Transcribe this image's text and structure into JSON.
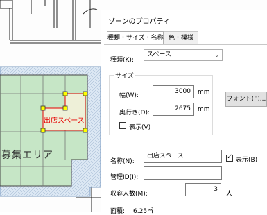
{
  "canvas": {
    "area_label": "募集エリア",
    "shop_label": "出店スペース"
  },
  "dialog": {
    "title": "ゾーンのプロパティ",
    "tabs": [
      {
        "label": "種類・サイズ・名称",
        "active": true
      },
      {
        "label": "色・模様",
        "active": false
      }
    ],
    "type": {
      "label": "種類(K):",
      "value": "スペース"
    },
    "size_group": {
      "title": "サイズ",
      "width": {
        "label": "幅(W):",
        "value": "3000",
        "unit": "mm"
      },
      "depth": {
        "label": "奥行き(D):",
        "value": "2675",
        "unit": "mm"
      },
      "show": {
        "label": "表示(V)",
        "checked": false
      }
    },
    "font_button": "フォント(F)...",
    "name": {
      "label": "名称(N):",
      "value": "出店スペース"
    },
    "name_show": {
      "label": "表示(B)",
      "checked": true
    },
    "manage_id": {
      "label": "管理ID(I):",
      "value": ""
    },
    "capacity": {
      "label": "収容人数(M):",
      "value": "3",
      "unit": "人"
    },
    "area": {
      "label": "面積:",
      "value": "6.25㎡"
    }
  },
  "colors": {
    "zone_fill": "#c6e6c6",
    "hatch_fill": "#dbe7f3",
    "shop_fill": "#eef0d8",
    "handle": "#ffff00",
    "shop_border": "#e60000"
  }
}
